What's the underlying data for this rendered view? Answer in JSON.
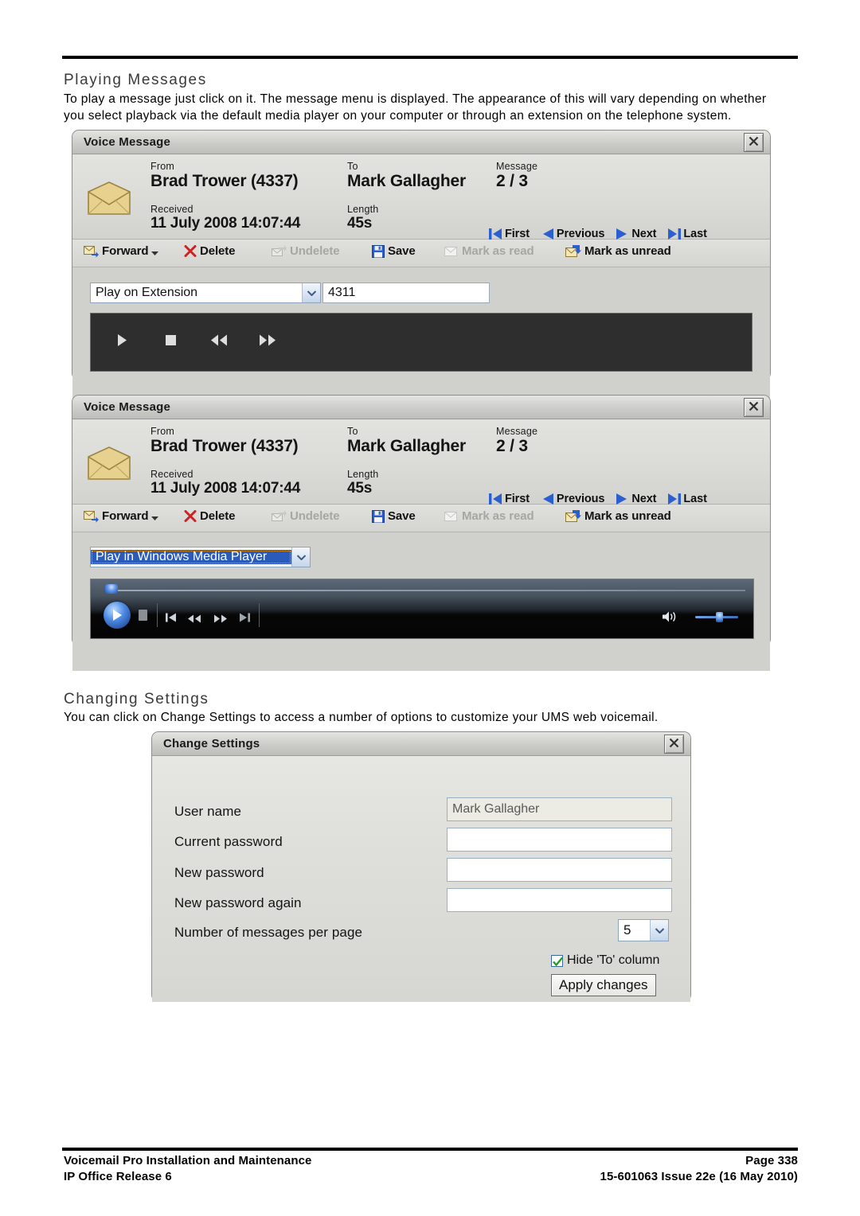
{
  "document": {
    "section1": {
      "heading": "Playing Messages",
      "paragraph_line1": "To play a message just click on it. The message menu is displayed. The appearance of this will vary depending on whether",
      "paragraph_line2": "you select playback via the default media player on your computer or through an extension on the telephone system."
    },
    "section2": {
      "heading": "Changing Settings",
      "paragraph": "You can click on Change Settings to access a number of options to customize your UMS web voicemail."
    }
  },
  "voice_message": {
    "title": "Voice Message",
    "labels": {
      "from": "From",
      "to": "To",
      "message": "Message",
      "received": "Received",
      "length": "Length"
    },
    "values": {
      "from": "Brad Trower (4337)",
      "to": "Mark Gallagher",
      "message": "2 / 3",
      "received": "11 July 2008 14:07:44",
      "length": "45s"
    },
    "nav": {
      "first": "First",
      "previous": "Previous",
      "next": "Next",
      "last": "Last"
    },
    "toolbar": {
      "forward": "Forward",
      "delete": "Delete",
      "undelete": "Undelete",
      "save": "Save",
      "mark_as_read": "Mark as read",
      "mark_as_unread": "Mark as unread"
    }
  },
  "dialog1": {
    "playback_mode": "Play on Extension",
    "extension": "4311"
  },
  "dialog2": {
    "playback_mode": "Play in Windows Media Player"
  },
  "change_settings": {
    "title": "Change Settings",
    "fields": {
      "user_name_label": "User name",
      "user_name_value": "Mark Gallagher",
      "current_password_label": "Current password",
      "current_password_value": "",
      "new_password_label": "New password",
      "new_password_value": "",
      "new_password_again_label": "New password again",
      "new_password_again_value": "",
      "messages_per_page_label": "Number of messages per page",
      "messages_per_page_value": "5"
    },
    "hide_to_column_label": "Hide 'To' column",
    "apply_button": "Apply changes"
  },
  "footer": {
    "left_line1": "Voicemail Pro Installation and Maintenance",
    "left_line2": "IP Office Release 6",
    "right_line1": "Page 338",
    "right_line2": "15-601063 Issue 22e (16 May 2010)"
  },
  "colors": {
    "accent_blue": "#2b5fd0",
    "delete_red": "#cc2222",
    "check_green": "#1f9b1f",
    "envelope_gold": "#e4cf8c"
  }
}
